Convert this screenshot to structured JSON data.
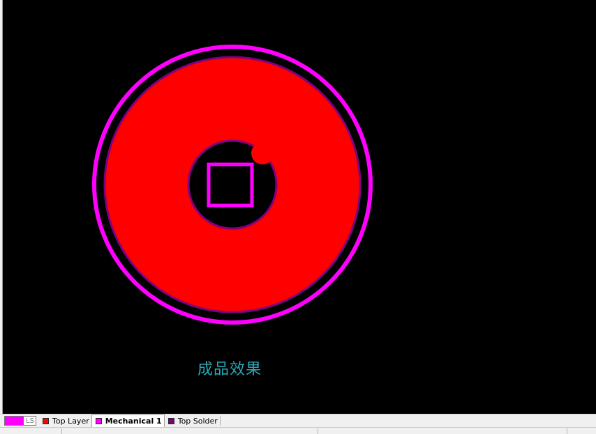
{
  "canvas": {
    "background_color": "#000000",
    "caption": "成品效果",
    "caption_color": "#2aa7b5"
  },
  "drawing": {
    "outer_ring_color": "#ff00ff",
    "pad_fill_color": "#ff0000",
    "solder_outline_color": "#800080",
    "square_color": "#ff00ff"
  },
  "layer_tabs": {
    "ls_label": "LS",
    "ls_color": "#ff00ff",
    "items": [
      {
        "label": "Top Layer",
        "color": "#ff0000",
        "active": false
      },
      {
        "label": "Mechanical 1",
        "color": "#ff00ff",
        "active": true
      },
      {
        "label": "Top Solder",
        "color": "#800080",
        "active": false
      }
    ]
  }
}
